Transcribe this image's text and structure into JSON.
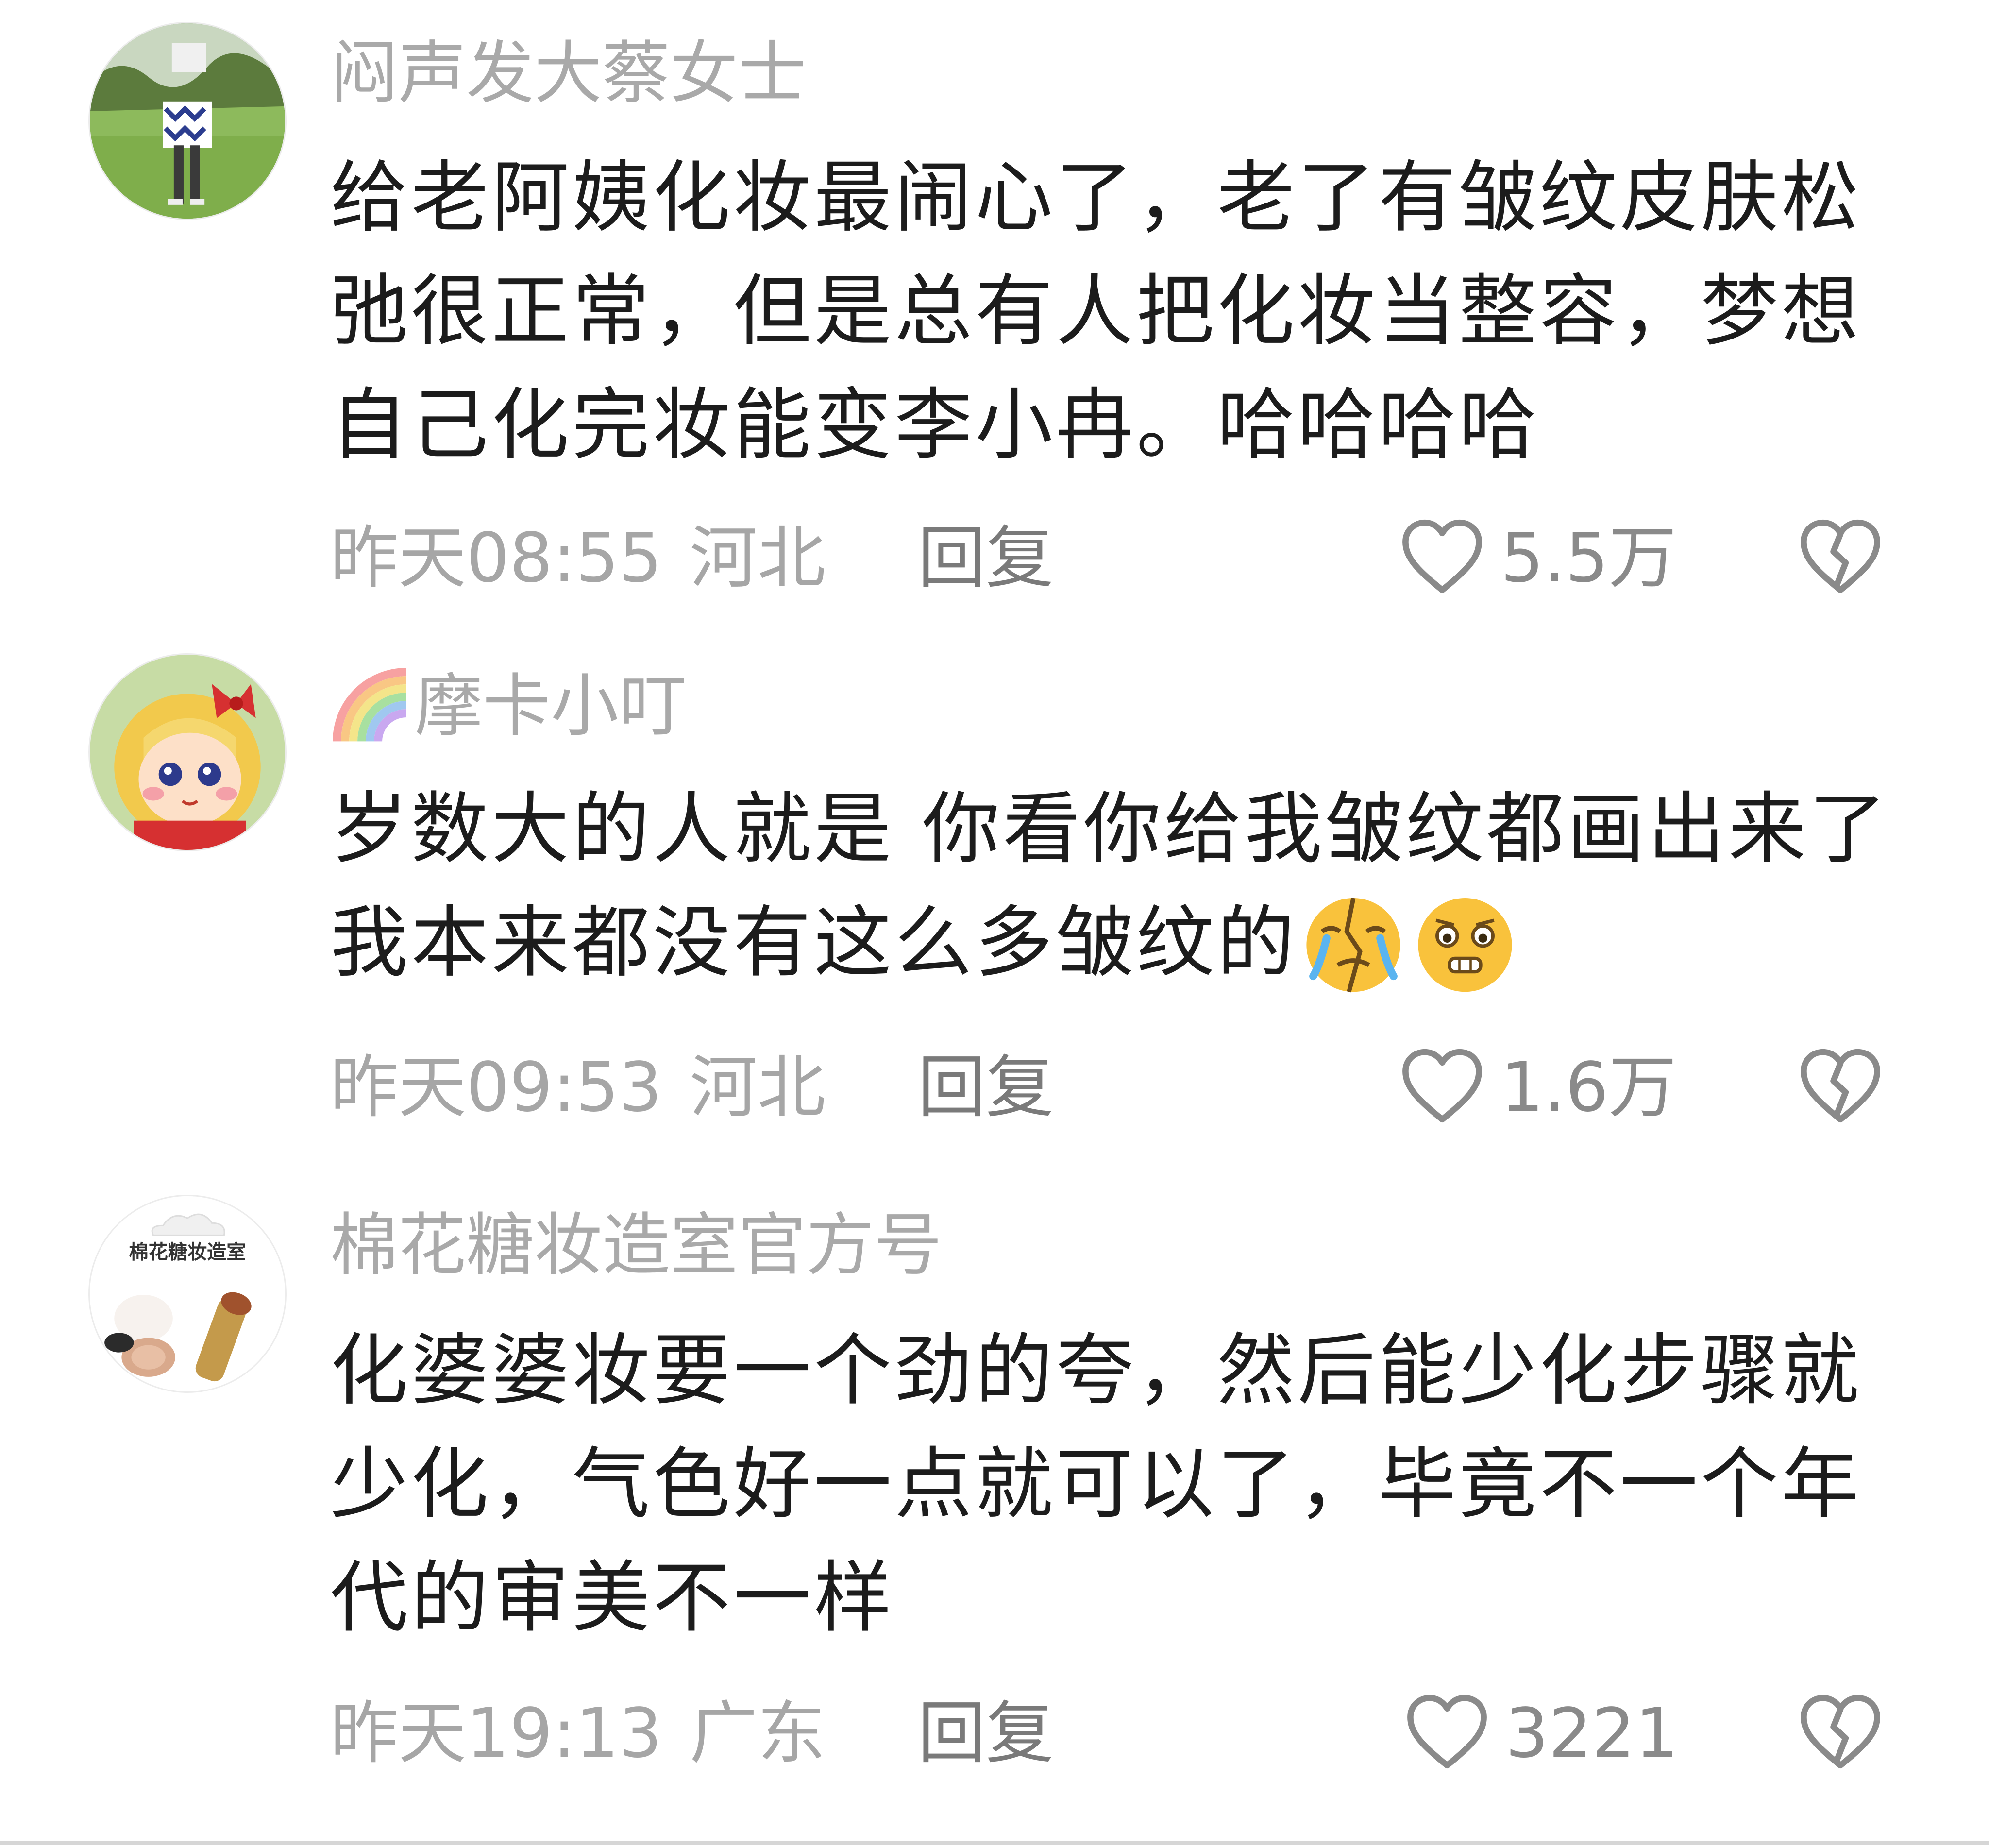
{
  "comments": [
    {
      "username": "闷声发大蔡女士",
      "text": "给老阿姨化妆最闹心了，老了有皱纹皮肤松弛很正常，但是总有人把化妆当整容，梦想自己化完妆能变李小冉。哈哈哈哈",
      "time": "昨天08:55",
      "location": "河北",
      "reply_label": "回复",
      "likes": "5.5万",
      "avatar": "outdoor-photo-avatar"
    },
    {
      "username": "摩卡小叮",
      "username_prefix_icon": "rainbow-icon",
      "text": "岁数大的人就是 你看你给我皱纹都画出来了 我本来都没有这么多皱纹的",
      "emojis": [
        "crying-heartbroken-emoji",
        "pleading-grimace-emoji"
      ],
      "time": "昨天09:53",
      "location": "河北",
      "reply_label": "回复",
      "likes": "1.6万",
      "avatar": "cartoon-girl-avatar"
    },
    {
      "username": "棉花糖妆造室官方号",
      "text": "化婆婆妆要一个劲的夸，然后能少化步骤就少化，气色好一点就可以了，毕竟不一个年代的审美不一样",
      "time": "昨天19:13",
      "location": "广东",
      "reply_label": "回复",
      "likes": "3221",
      "avatar": "makeup-studio-logo-avatar",
      "avatar_text": "棉花糖妆造室"
    }
  ],
  "colors": {
    "username": "#a9a9a9",
    "text": "#1c1c1c",
    "meta": "#a6a6a6",
    "icon": "#8a8a8a"
  }
}
